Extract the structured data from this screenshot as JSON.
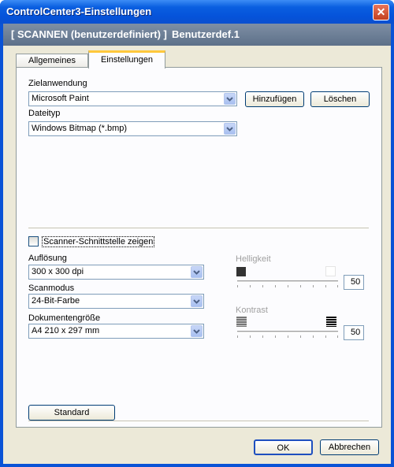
{
  "window": {
    "title": "ControlCenter3-Einstellungen"
  },
  "header": {
    "left": "[  SCANNEN (benutzerdefiniert)  ]",
    "right": "Benutzerdef.1"
  },
  "tabs": [
    {
      "label": "Allgemeines"
    },
    {
      "label": "Einstellungen"
    }
  ],
  "target_app": {
    "label": "Zielanwendung",
    "value": "Microsoft Paint",
    "add_button": "Hinzufügen",
    "delete_button": "Löschen"
  },
  "file_type": {
    "label": "Dateityp",
    "value": "Windows Bitmap (*.bmp)"
  },
  "scanner_interface": {
    "label": "Scanner-Schnittstelle zeigen",
    "checked": false
  },
  "resolution": {
    "label": "Auflösung",
    "value": "300 x 300 dpi"
  },
  "scan_mode": {
    "label": "Scanmodus",
    "value": "24-Bit-Farbe"
  },
  "document_size": {
    "label": "Dokumentengröße",
    "value": "A4 210 x 297 mm"
  },
  "brightness": {
    "label": "Helligkeit",
    "value": "50"
  },
  "contrast": {
    "label": "Kontrast",
    "value": "50"
  },
  "buttons": {
    "default": "Standard",
    "ok": "OK",
    "cancel": "Abbrechen"
  },
  "colors": {
    "title_bar": "#0553da",
    "dialog_bg": "#ece9d8",
    "header_bg": "#6b7d93",
    "tab_accent": "#ffc83c"
  }
}
